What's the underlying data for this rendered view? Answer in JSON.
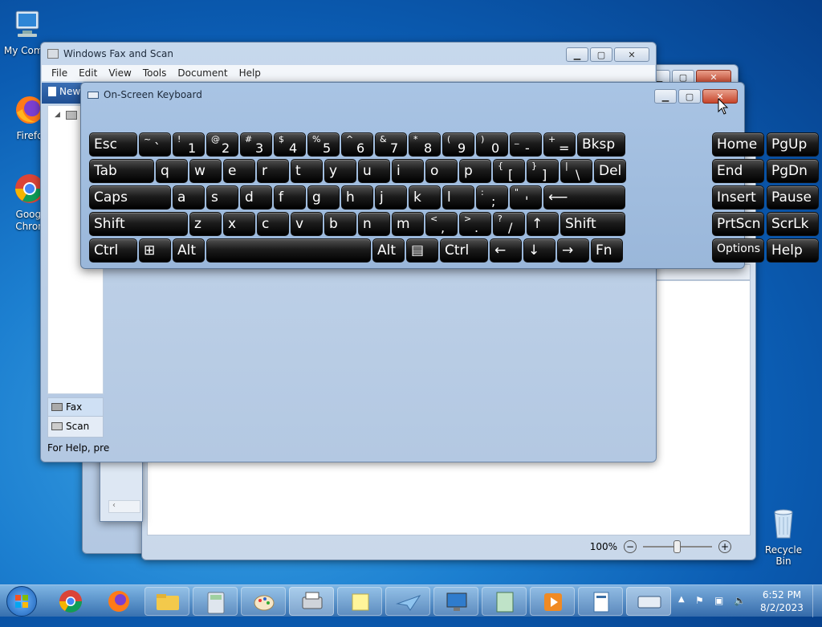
{
  "desktop": {
    "icons": [
      {
        "label": "My Comp"
      },
      {
        "label": "Firefo"
      },
      {
        "label": "Googl Chron"
      },
      {
        "label": "Recycle Bin"
      }
    ]
  },
  "fax_window": {
    "title": "Windows Fax and Scan",
    "menu": [
      "File",
      "Edit",
      "View",
      "Tools",
      "Document",
      "Help"
    ],
    "new_button": "New",
    "nav_items": [
      "Fax",
      "Scan"
    ],
    "status": "For Help, pre"
  },
  "doc_window": {
    "zoom": "100%"
  },
  "osk": {
    "title": "On-Screen Keyboard",
    "rows": [
      [
        {
          "t": "Esc"
        },
        {
          "s": "~",
          "m": "`"
        },
        {
          "s": "!",
          "m": "1"
        },
        {
          "s": "@",
          "m": "2"
        },
        {
          "s": "#",
          "m": "3"
        },
        {
          "s": "$",
          "m": "4"
        },
        {
          "s": "%",
          "m": "5"
        },
        {
          "s": "^",
          "m": "6"
        },
        {
          "s": "&",
          "m": "7"
        },
        {
          "s": "*",
          "m": "8"
        },
        {
          "s": "(",
          "m": "9"
        },
        {
          "s": ")",
          "m": "0"
        },
        {
          "s": "_",
          "m": "-"
        },
        {
          "s": "+",
          "m": "="
        },
        {
          "t": "Bksp"
        },
        {
          "t": "Home"
        },
        {
          "t": "PgUp"
        }
      ],
      [
        {
          "t": "Tab"
        },
        {
          "t": "q"
        },
        {
          "t": "w"
        },
        {
          "t": "e"
        },
        {
          "t": "r"
        },
        {
          "t": "t"
        },
        {
          "t": "y"
        },
        {
          "t": "u"
        },
        {
          "t": "i"
        },
        {
          "t": "o"
        },
        {
          "t": "p"
        },
        {
          "s": "{",
          "m": "["
        },
        {
          "s": "}",
          "m": "]"
        },
        {
          "s": "|",
          "m": "\\"
        },
        {
          "t": "Del"
        },
        {
          "t": "End"
        },
        {
          "t": "PgDn"
        }
      ],
      [
        {
          "t": "Caps"
        },
        {
          "t": "a"
        },
        {
          "t": "s"
        },
        {
          "t": "d"
        },
        {
          "t": "f"
        },
        {
          "t": "g"
        },
        {
          "t": "h"
        },
        {
          "t": "j"
        },
        {
          "t": "k"
        },
        {
          "t": "l"
        },
        {
          "s": ":",
          "m": ";"
        },
        {
          "s": "\"",
          "m": "'"
        },
        {
          "t": "⟵"
        },
        {
          "t": "Insert"
        },
        {
          "t": "Pause"
        }
      ],
      [
        {
          "t": "Shift"
        },
        {
          "t": "z"
        },
        {
          "t": "x"
        },
        {
          "t": "c"
        },
        {
          "t": "v"
        },
        {
          "t": "b"
        },
        {
          "t": "n"
        },
        {
          "t": "m"
        },
        {
          "s": "<",
          "m": ","
        },
        {
          "s": ">",
          "m": "."
        },
        {
          "s": "?",
          "m": "/"
        },
        {
          "t": "↑"
        },
        {
          "t": "Shift"
        },
        {
          "t": "PrtScn"
        },
        {
          "t": "ScrLk"
        }
      ],
      [
        {
          "t": "Ctrl"
        },
        {
          "t": "⊞"
        },
        {
          "t": "Alt"
        },
        {
          "t": ""
        },
        {
          "t": "Alt"
        },
        {
          "t": "▤"
        },
        {
          "t": "Ctrl"
        },
        {
          "t": "←"
        },
        {
          "t": "↓"
        },
        {
          "t": "→"
        },
        {
          "t": "Fn"
        },
        {
          "t": "Options"
        },
        {
          "t": "Help"
        }
      ]
    ]
  },
  "tray": {
    "time": "6:52 PM",
    "date": "8/2/2023"
  }
}
